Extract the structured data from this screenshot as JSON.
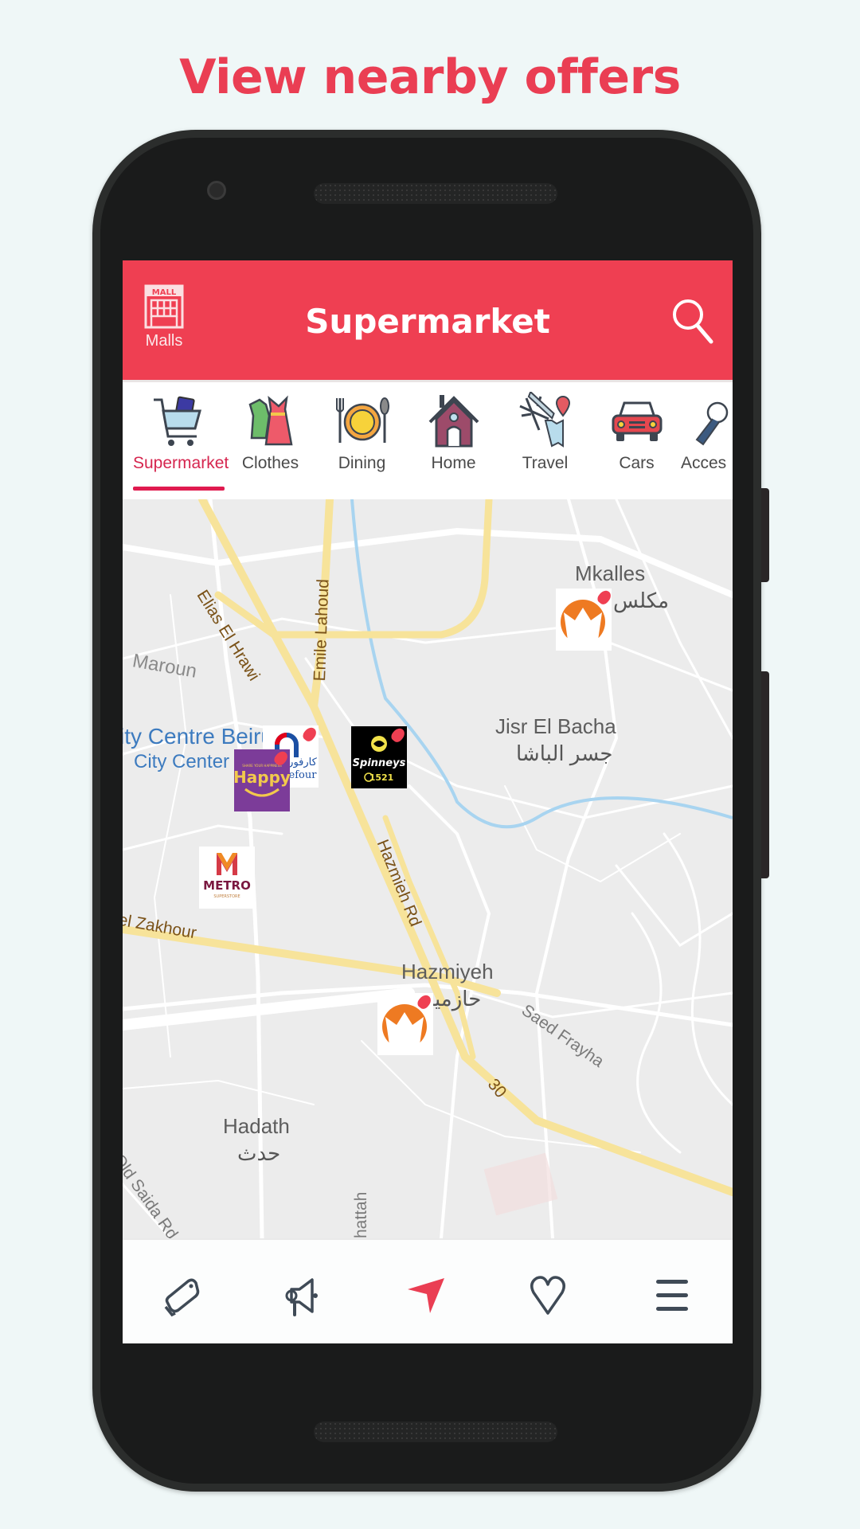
{
  "headline": "View nearby offers",
  "appbar": {
    "title": "Supermarket",
    "malls_label": "Malls",
    "malls_icon_text": "MALL",
    "malls_icon": "mall-building-icon",
    "search_icon": "search-icon"
  },
  "categories": [
    {
      "label": "Supermarket",
      "icon": "shopping-cart-icon",
      "active": true
    },
    {
      "label": "Clothes",
      "icon": "clothes-icon",
      "active": false
    },
    {
      "label": "Dining",
      "icon": "dining-plate-icon",
      "active": false
    },
    {
      "label": "Home",
      "icon": "house-icon",
      "active": false
    },
    {
      "label": "Travel",
      "icon": "travel-plane-map-icon",
      "active": false
    },
    {
      "label": "Cars",
      "icon": "car-icon",
      "active": false
    },
    {
      "label": "Acces",
      "icon": "accessories-icon",
      "active": false
    }
  ],
  "map": {
    "places": [
      {
        "name": "Mkalles",
        "arabic": "مكلس"
      },
      {
        "name": "Jisr El Bacha",
        "arabic": "جسر الباشا"
      },
      {
        "name": "Hazmiyeh",
        "arabic": "حازمية"
      },
      {
        "name": "Hadath",
        "arabic": "حدث"
      },
      {
        "name": "Maroun"
      }
    ],
    "pois": [
      "ity Centre Beiru",
      "City Center B"
    ],
    "roads": [
      "Elias El Hrawi",
      "Emile Lahoud",
      "Hazmieh Rd",
      "el Zakhour",
      "Saed Frayha",
      "Old Saida Rd",
      "30",
      "hattah"
    ],
    "markers": [
      {
        "brand": "Fakhani",
        "logo": "orange-crown-logo"
      },
      {
        "brand": "Spinneys",
        "hotline": "1521"
      },
      {
        "brand": "Carrefour",
        "arabic": "كارفور",
        "partial_text": "efour"
      },
      {
        "brand": "Happy",
        "tagline": "SHARE YOUR HAPPINESS"
      },
      {
        "brand": "METRO",
        "sub": "SUPERSTORE"
      },
      {
        "brand": "Fakhani",
        "logo": "orange-crown-logo"
      }
    ]
  },
  "bottom_nav": [
    {
      "name": "offers",
      "icon": "tags-icon",
      "active": false
    },
    {
      "name": "announcements",
      "icon": "megaphone-icon",
      "active": false
    },
    {
      "name": "nearby",
      "icon": "location-arrow-icon",
      "active": true
    },
    {
      "name": "favorites",
      "icon": "heart-icon",
      "active": false
    },
    {
      "name": "menu",
      "icon": "hamburger-menu-icon",
      "active": false
    }
  ],
  "colors": {
    "brand": "#ef3f52",
    "active_tab": "#d6264f",
    "nav_icon": "#3f4a56",
    "background": "#eff7f7"
  }
}
